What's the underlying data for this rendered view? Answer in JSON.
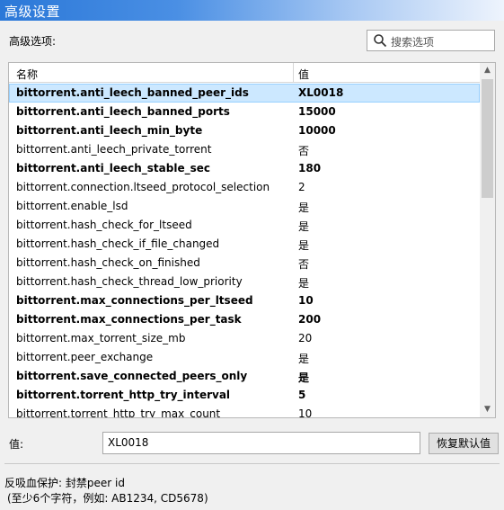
{
  "window": {
    "title": "高级设置"
  },
  "advanced_label": "高级选项:",
  "search": {
    "placeholder": "搜索选项"
  },
  "table": {
    "columns": [
      "名称",
      "值"
    ],
    "rows": [
      {
        "name": "bittorrent.anti_leech_banned_peer_ids",
        "value": "XL0018",
        "modified": true,
        "selected": true
      },
      {
        "name": "bittorrent.anti_leech_banned_ports",
        "value": "15000",
        "modified": true,
        "selected": false
      },
      {
        "name": "bittorrent.anti_leech_min_byte",
        "value": "10000",
        "modified": true,
        "selected": false
      },
      {
        "name": "bittorrent.anti_leech_private_torrent",
        "value": "否",
        "modified": false,
        "selected": false
      },
      {
        "name": "bittorrent.anti_leech_stable_sec",
        "value": "180",
        "modified": true,
        "selected": false
      },
      {
        "name": "bittorrent.connection.ltseed_protocol_selection",
        "value": "2",
        "modified": false,
        "selected": false
      },
      {
        "name": "bittorrent.enable_lsd",
        "value": "是",
        "modified": false,
        "selected": false
      },
      {
        "name": "bittorrent.hash_check_for_ltseed",
        "value": "是",
        "modified": false,
        "selected": false
      },
      {
        "name": "bittorrent.hash_check_if_file_changed",
        "value": "是",
        "modified": false,
        "selected": false
      },
      {
        "name": "bittorrent.hash_check_on_finished",
        "value": "否",
        "modified": false,
        "selected": false
      },
      {
        "name": "bittorrent.hash_check_thread_low_priority",
        "value": "是",
        "modified": false,
        "selected": false
      },
      {
        "name": "bittorrent.max_connections_per_ltseed",
        "value": "10",
        "modified": true,
        "selected": false
      },
      {
        "name": "bittorrent.max_connections_per_task",
        "value": "200",
        "modified": true,
        "selected": false
      },
      {
        "name": "bittorrent.max_torrent_size_mb",
        "value": "20",
        "modified": false,
        "selected": false
      },
      {
        "name": "bittorrent.peer_exchange",
        "value": "是",
        "modified": false,
        "selected": false
      },
      {
        "name": "bittorrent.save_connected_peers_only",
        "value": "是",
        "modified": true,
        "selected": false
      },
      {
        "name": "bittorrent.torrent_http_try_interval",
        "value": "5",
        "modified": true,
        "selected": false
      },
      {
        "name": "bittorrent.torrent_http_try_max_count",
        "value": "10",
        "modified": false,
        "selected": false
      }
    ]
  },
  "value_editor": {
    "label": "值:",
    "value": "XL0018",
    "reset_label": "恢复默认值"
  },
  "description": {
    "line1": "反吸血保护: 封禁peer id",
    "line2": "(至少6个字符，例如: AB1234, CD5678)"
  },
  "colors": {
    "title_bar": "#2b78d8",
    "selection": "#cce8ff"
  },
  "icons": {
    "search": "search-icon",
    "scroll_up": "chevron-up-icon",
    "scroll_down": "chevron-down-icon"
  }
}
